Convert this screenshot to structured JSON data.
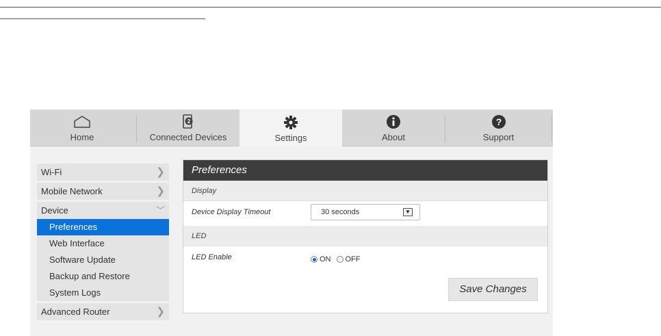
{
  "tabs": [
    {
      "label": "Home",
      "icon": "home-icon",
      "active": false
    },
    {
      "label": "Connected Devices",
      "icon": "connected-devices-icon",
      "badge": "2",
      "active": false
    },
    {
      "label": "Settings",
      "icon": "gear-icon",
      "active": true
    },
    {
      "label": "About",
      "icon": "info-icon",
      "active": false
    },
    {
      "label": "Support",
      "icon": "help-icon",
      "active": false
    }
  ],
  "sidebar": {
    "wifi": "Wi-Fi",
    "mobile_network": "Mobile Network",
    "device": "Device",
    "device_items": [
      "Preferences",
      "Web Interface",
      "Software Update",
      "Backup and Restore",
      "System Logs"
    ],
    "active_item": "Preferences",
    "advanced_router": "Advanced Router"
  },
  "panel": {
    "title": "Preferences",
    "display_section": "Display",
    "timeout_label": "Device Display Timeout",
    "timeout_value": "30 seconds",
    "led_section": "LED",
    "led_label": "LED Enable",
    "led_on": "ON",
    "led_off": "OFF",
    "led_selected": "ON",
    "save_label": "Save Changes"
  },
  "colors": {
    "accent_blue": "#0a72d8",
    "panel_header": "#3d3d3d",
    "tab_bg": "#d6d6d6"
  }
}
